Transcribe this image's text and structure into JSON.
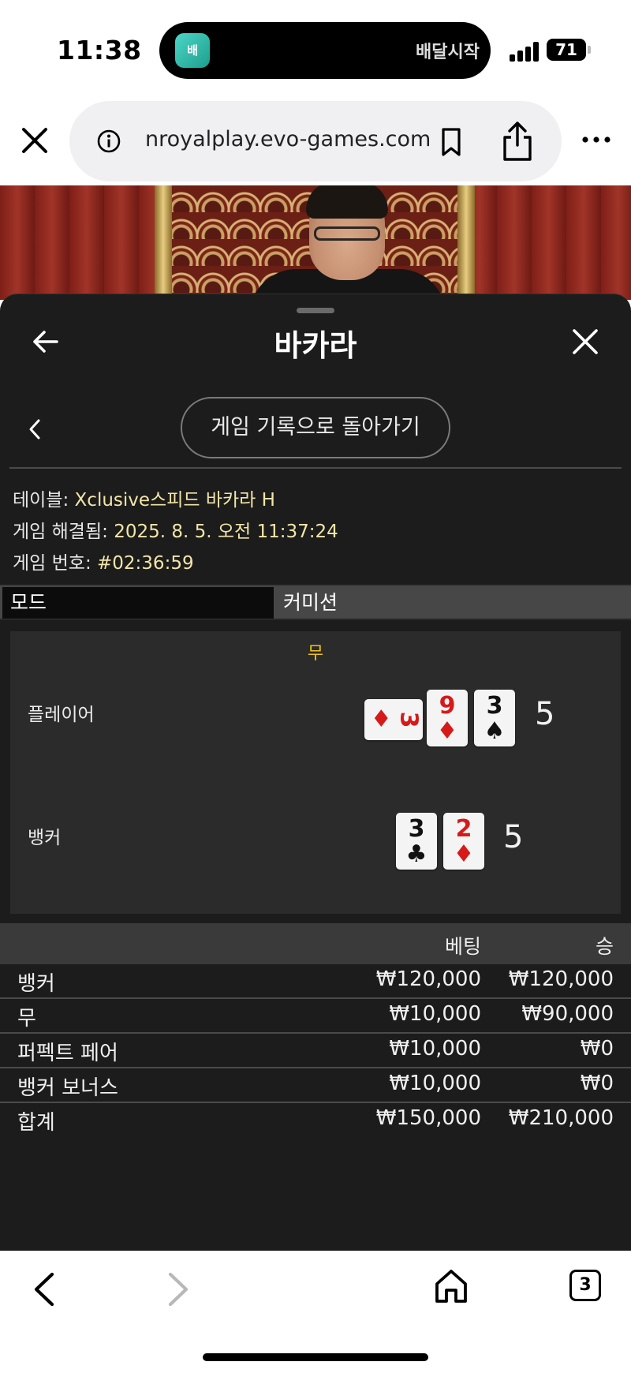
{
  "status_bar": {
    "time": "11:38",
    "app_badge": "배",
    "activity_text": "배달시작",
    "battery": "71"
  },
  "browser": {
    "url": "nroyalplay.evo-games.com"
  },
  "modal": {
    "title": "바카라",
    "history_button": "게임 기록으로 돌아가기",
    "table_label": "테이블:",
    "table_value": "Xclusive스피드 바카라 H",
    "resolved_label": "게임 해결됨:",
    "resolved_value": "2025. 8. 5. 오전 11:37:24",
    "number_label": "게임 번호:",
    "number_value": "#02:36:59",
    "mode_label": "모드",
    "commission_label": "커미션",
    "result": {
      "outcome": "무",
      "player_label": "플레이어",
      "player_total": "5",
      "player_cards": [
        {
          "rank": "3",
          "suit": "♦",
          "color": "red",
          "orientation": "sideways"
        },
        {
          "rank": "9",
          "suit": "♦",
          "color": "red"
        },
        {
          "rank": "3",
          "suit": "♠",
          "color": "black"
        }
      ],
      "banker_label": "뱅커",
      "banker_total": "5",
      "banker_cards": [
        {
          "rank": "3",
          "suit": "♣",
          "color": "black"
        },
        {
          "rank": "2",
          "suit": "♦",
          "color": "red"
        }
      ]
    },
    "bets": {
      "header_bet": "베팅",
      "header_win": "승",
      "rows": [
        {
          "name": "뱅커",
          "bet": "₩120,000",
          "win": "₩120,000"
        },
        {
          "name": "무",
          "bet": "₩10,000",
          "win": "₩90,000"
        },
        {
          "name": "퍼펙트 페어",
          "bet": "₩10,000",
          "win": "₩0"
        },
        {
          "name": "뱅커 보너스",
          "bet": "₩10,000",
          "win": "₩0"
        }
      ],
      "total": {
        "name": "합계",
        "bet": "₩150,000",
        "win": "₩210,000"
      }
    }
  },
  "toolbar": {
    "tab_count": "3"
  },
  "colors": {
    "modal_bg": "#1c1c1c",
    "panel_bg": "#2b2b2b",
    "info_value": "#f3e5a8",
    "outcome": "#f2c21b",
    "card_red": "#d61a1a"
  }
}
